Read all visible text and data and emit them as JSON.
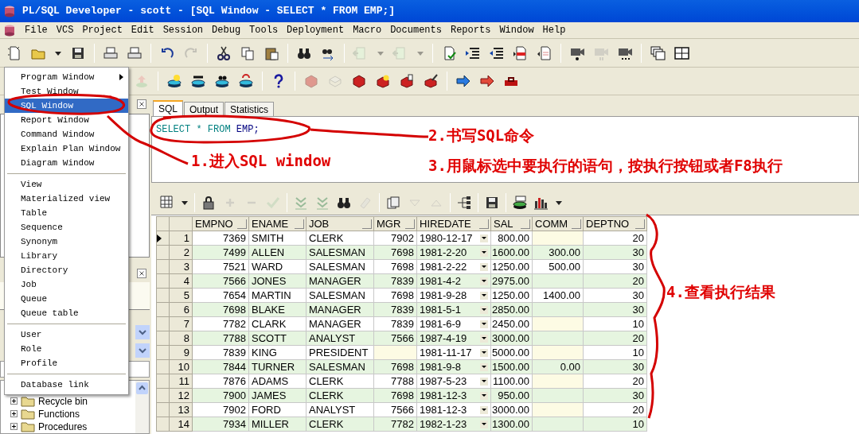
{
  "window": {
    "title": "PL/SQL Developer - scott - [SQL Window - SELECT * FROM EMP;]"
  },
  "menu_bar": [
    "File",
    "VCS",
    "Project",
    "Edit",
    "Session",
    "Debug",
    "Tools",
    "Deployment",
    "Macro",
    "Documents",
    "Reports",
    "Window",
    "Help"
  ],
  "new_menu": {
    "groups": [
      {
        "items": [
          {
            "label": "Program Window",
            "submenu": true,
            "selected": false
          },
          {
            "label": "Test Window",
            "submenu": false,
            "selected": false
          },
          {
            "label": "SQL Window",
            "submenu": false,
            "selected": true
          },
          {
            "label": "Report Window",
            "submenu": false,
            "selected": false
          },
          {
            "label": "Command Window",
            "submenu": false,
            "selected": false
          },
          {
            "label": "Explain Plan Window",
            "submenu": false,
            "selected": false
          },
          {
            "label": "Diagram Window",
            "submenu": false,
            "selected": false
          }
        ]
      },
      {
        "items": [
          {
            "label": "View",
            "submenu": false,
            "selected": false
          },
          {
            "label": "Materialized view",
            "submenu": false,
            "selected": false
          },
          {
            "label": "Table",
            "submenu": false,
            "selected": false
          },
          {
            "label": "Sequence",
            "submenu": false,
            "selected": false
          },
          {
            "label": "Synonym",
            "submenu": false,
            "selected": false
          },
          {
            "label": "Library",
            "submenu": false,
            "selected": false
          },
          {
            "label": "Directory",
            "submenu": false,
            "selected": false
          },
          {
            "label": "Job",
            "submenu": false,
            "selected": false
          },
          {
            "label": "Queue",
            "submenu": false,
            "selected": false
          },
          {
            "label": "Queue table",
            "submenu": false,
            "selected": false
          }
        ]
      },
      {
        "items": [
          {
            "label": "User",
            "submenu": false,
            "selected": false
          },
          {
            "label": "Role",
            "submenu": false,
            "selected": false
          },
          {
            "label": "Profile",
            "submenu": false,
            "selected": false
          }
        ]
      },
      {
        "items": [
          {
            "label": "Database link",
            "submenu": false,
            "selected": false
          }
        ]
      }
    ]
  },
  "object_tree": [
    {
      "label": "Recycle bin",
      "expanded": false
    },
    {
      "label": "Functions",
      "expanded": false
    },
    {
      "label": "Procedures",
      "expanded": false
    }
  ],
  "editor": {
    "tabs": [
      {
        "label": "SQL",
        "selected": true
      },
      {
        "label": "Output",
        "selected": false
      },
      {
        "label": "Statistics",
        "selected": false
      }
    ],
    "sql": [
      {
        "text": "SELECT",
        "kind": "keyword"
      },
      {
        "text": "*",
        "kind": "operator"
      },
      {
        "text": "FROM",
        "kind": "keyword"
      },
      {
        "text": "EMP;",
        "kind": "identifier"
      }
    ]
  },
  "results": {
    "columns": [
      {
        "label": "EMPNO",
        "kind": "number"
      },
      {
        "label": "ENAME",
        "kind": "text"
      },
      {
        "label": "JOB",
        "kind": "text"
      },
      {
        "label": "MGR",
        "kind": "number"
      },
      {
        "label": "HIREDATE",
        "kind": "date"
      },
      {
        "label": "SAL",
        "kind": "number"
      },
      {
        "label": "COMM",
        "kind": "number"
      },
      {
        "label": "DEPTNO",
        "kind": "number"
      }
    ],
    "rows": [
      {
        "number": "1",
        "selected": true,
        "cells": [
          "7369",
          "SMITH",
          "CLERK",
          "7902",
          "1980-12-17",
          "800.00",
          null,
          "20"
        ]
      },
      {
        "number": "2",
        "selected": false,
        "cells": [
          "7499",
          "ALLEN",
          "SALESMAN",
          "7698",
          "1981-2-20",
          "1600.00",
          "300.00",
          "30"
        ]
      },
      {
        "number": "3",
        "selected": false,
        "cells": [
          "7521",
          "WARD",
          "SALESMAN",
          "7698",
          "1981-2-22",
          "1250.00",
          "500.00",
          "30"
        ]
      },
      {
        "number": "4",
        "selected": false,
        "cells": [
          "7566",
          "JONES",
          "MANAGER",
          "7839",
          "1981-4-2",
          "2975.00",
          null,
          "20"
        ]
      },
      {
        "number": "5",
        "selected": false,
        "cells": [
          "7654",
          "MARTIN",
          "SALESMAN",
          "7698",
          "1981-9-28",
          "1250.00",
          "1400.00",
          "30"
        ]
      },
      {
        "number": "6",
        "selected": false,
        "cells": [
          "7698",
          "BLAKE",
          "MANAGER",
          "7839",
          "1981-5-1",
          "2850.00",
          null,
          "30"
        ]
      },
      {
        "number": "7",
        "selected": false,
        "cells": [
          "7782",
          "CLARK",
          "MANAGER",
          "7839",
          "1981-6-9",
          "2450.00",
          null,
          "10"
        ]
      },
      {
        "number": "8",
        "selected": false,
        "cells": [
          "7788",
          "SCOTT",
          "ANALYST",
          "7566",
          "1987-4-19",
          "3000.00",
          null,
          "20"
        ]
      },
      {
        "number": "9",
        "selected": false,
        "cells": [
          "7839",
          "KING",
          "PRESIDENT",
          null,
          "1981-11-17",
          "5000.00",
          null,
          "10"
        ]
      },
      {
        "number": "10",
        "selected": false,
        "cells": [
          "7844",
          "TURNER",
          "SALESMAN",
          "7698",
          "1981-9-8",
          "1500.00",
          "0.00",
          "30"
        ]
      },
      {
        "number": "11",
        "selected": false,
        "cells": [
          "7876",
          "ADAMS",
          "CLERK",
          "7788",
          "1987-5-23",
          "1100.00",
          null,
          "20"
        ]
      },
      {
        "number": "12",
        "selected": false,
        "cells": [
          "7900",
          "JAMES",
          "CLERK",
          "7698",
          "1981-12-3",
          "950.00",
          null,
          "30"
        ]
      },
      {
        "number": "13",
        "selected": false,
        "cells": [
          "7902",
          "FORD",
          "ANALYST",
          "7566",
          "1981-12-3",
          "3000.00",
          null,
          "20"
        ]
      },
      {
        "number": "14",
        "selected": false,
        "cells": [
          "7934",
          "MILLER",
          "CLERK",
          "7782",
          "1982-1-23",
          "1300.00",
          null,
          "10"
        ]
      }
    ]
  },
  "annotations": [
    {
      "text": "1.进入SQL window"
    },
    {
      "text": "2.书写SQL命令"
    },
    {
      "text": "3.用鼠标选中要执行的语句，按执行按钮或者F8执行"
    },
    {
      "text": "4.查看执行结果"
    }
  ]
}
